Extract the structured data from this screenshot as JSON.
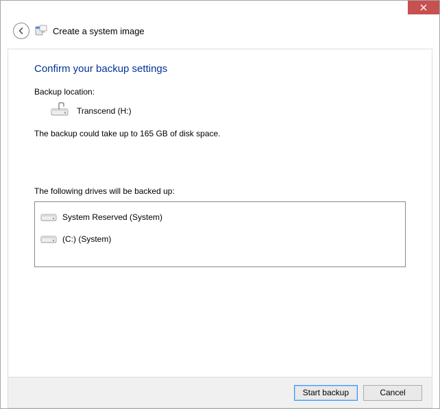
{
  "header": {
    "title": "Create a system image"
  },
  "page": {
    "title": "Confirm your backup settings",
    "backup_location_label": "Backup location:",
    "backup_location_value": "Transcend (H:)",
    "disk_estimate": "The backup could take up to 165 GB of disk space.",
    "drives_label": "The following drives will be backed up:",
    "drives": [
      {
        "label": "System Reserved (System)"
      },
      {
        "label": "(C:) (System)"
      }
    ]
  },
  "footer": {
    "start_label": "Start backup",
    "cancel_label": "Cancel"
  }
}
